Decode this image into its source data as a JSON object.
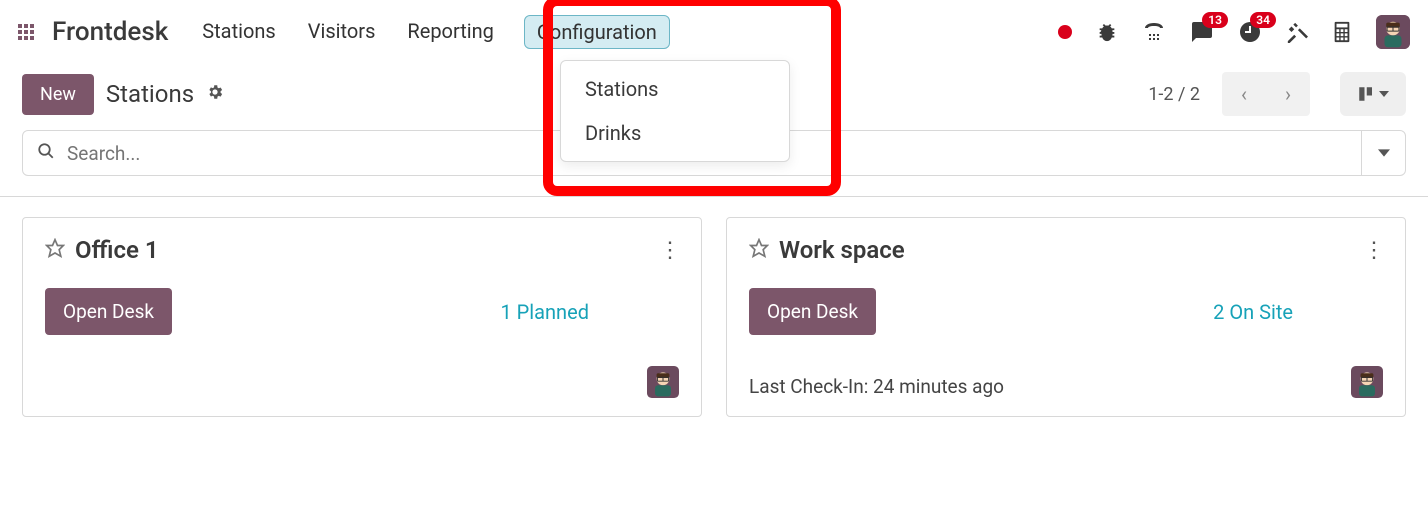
{
  "header": {
    "app_title": "Frontdesk",
    "menu": [
      "Stations",
      "Visitors",
      "Reporting",
      "Configuration"
    ],
    "active_menu_index": 3,
    "dropdown": [
      "Stations",
      "Drinks"
    ],
    "badges": {
      "messages": "13",
      "activities": "34"
    }
  },
  "control": {
    "new_label": "New",
    "breadcrumb": "Stations",
    "pager": "1-2 / 2"
  },
  "search": {
    "placeholder": "Search..."
  },
  "cards": [
    {
      "title": "Office 1",
      "open_label": "Open Desk",
      "status": "1 Planned",
      "checkin": ""
    },
    {
      "title": "Work space",
      "open_label": "Open Desk",
      "status": "2 On Site",
      "checkin": "Last Check-In: 24 minutes ago"
    }
  ]
}
